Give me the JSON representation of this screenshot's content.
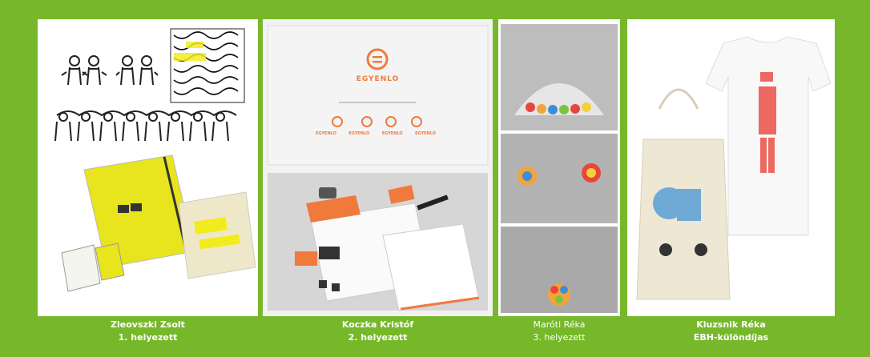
{
  "entries": [
    {
      "name": "Zleovszki Zsolt",
      "rank": "1. helyezett"
    },
    {
      "name": "Koczka Kristóf",
      "rank": "2. helyezett"
    },
    {
      "name": "Maróti Réka",
      "rank": "3. helyezett"
    },
    {
      "name": "Kluzsnik Réka",
      "rank": "EBH-különdíjas"
    }
  ],
  "logo": {
    "wordmark": "EGYENLO",
    "variants": [
      "EGYENLO",
      "EGYENLO",
      "EGYENLO",
      "EGYENLO"
    ]
  },
  "colors": {
    "background": "#76b82a",
    "accent_orange": "#f07a3c",
    "accent_yellow": "#f2ec1f"
  }
}
